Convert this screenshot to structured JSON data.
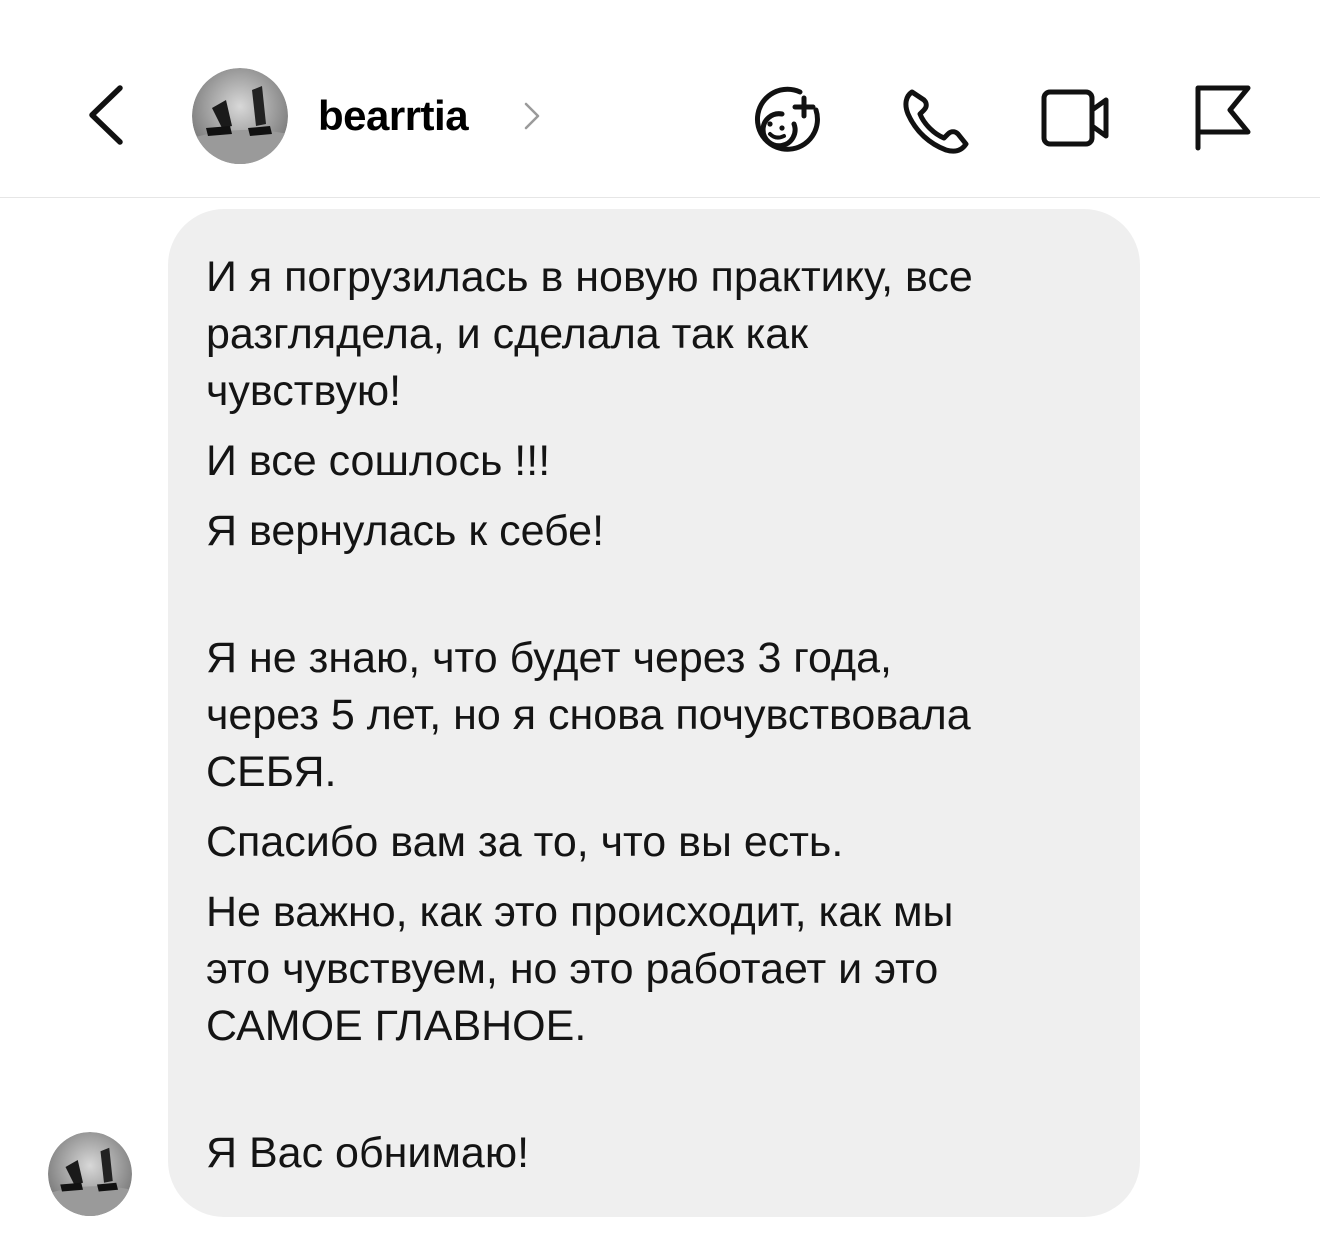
{
  "header": {
    "username": "bearrtia",
    "icons": [
      "back-chevron-icon",
      "avatar",
      "chevron-right-icon",
      "effects-sticker-icon",
      "phone-icon",
      "video-camera-icon",
      "flag-icon"
    ]
  },
  "message": {
    "lines": {
      "l1": "И я погрузилась в новую практику, все",
      "l2": "разглядела, и сделала так как",
      "l3": "чувствую!",
      "l4": "И все сошлось !!!",
      "l5": "Я вернулась к себе!",
      "l6": "Я не знаю, что будет через 3 года,",
      "l7": "через 5 лет, но я снова почувствовала",
      "l8": "СЕБЯ.",
      "l9": "Спасибо вам за то, что вы есть.",
      "l10": "Не важно, как это происходит, как мы",
      "l11": "это чувствуем, но это работает и это",
      "l12": "САМОЕ ГЛАВНОЕ.",
      "l13": "Я Вас обнимаю!"
    }
  },
  "colors": {
    "bubble": "#efefef",
    "text": "#141414",
    "divider": "#e6e6e6"
  }
}
